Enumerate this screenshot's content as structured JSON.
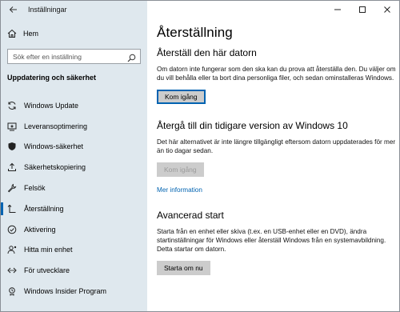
{
  "window": {
    "title": "Inställningar"
  },
  "sidebar": {
    "home_label": "Hem",
    "search_placeholder": "Sök efter en inställning",
    "section_heading": "Uppdatering och säkerhet",
    "items": [
      {
        "label": "Windows Update",
        "icon": "sync-icon"
      },
      {
        "label": "Leveransoptimering",
        "icon": "delivery-icon"
      },
      {
        "label": "Windows-säkerhet",
        "icon": "shield-icon"
      },
      {
        "label": "Säkerhetskopiering",
        "icon": "upload-icon"
      },
      {
        "label": "Felsök",
        "icon": "wrench-icon"
      },
      {
        "label": "Återställning",
        "icon": "recovery-icon",
        "active": true
      },
      {
        "label": "Aktivering",
        "icon": "checkmark-circle-icon"
      },
      {
        "label": "Hitta min enhet",
        "icon": "person-location-icon"
      },
      {
        "label": "För utvecklare",
        "icon": "developer-icon"
      },
      {
        "label": "Windows Insider Program",
        "icon": "insider-icon"
      }
    ]
  },
  "main": {
    "title": "Återställning",
    "reset": {
      "heading": "Återställ den här datorn",
      "text": "Om datorn inte fungerar som den ska kan du prova att återställa den. Du väljer om du vill behålla eller ta bort dina personliga filer, och sedan ominstalleras Windows.",
      "button": "Kom igång"
    },
    "goback": {
      "heading": "Återgå till din tidigare version av Windows 10",
      "text": "Det här alternativet är inte längre tillgängligt eftersom datorn uppdaterades för mer än tio dagar sedan.",
      "button": "Kom igång",
      "link": "Mer information"
    },
    "advanced": {
      "heading": "Avancerad start",
      "text": "Starta från en enhet eller skiva (t.ex. en USB-enhet eller en DVD), ändra startinställningar för Windows eller återställ Windows från en systemavbildning. Detta startar om datorn.",
      "button": "Starta om nu"
    }
  },
  "colors": {
    "accent": "#0063b1",
    "sidebar_bg": "#dfe8ee"
  }
}
